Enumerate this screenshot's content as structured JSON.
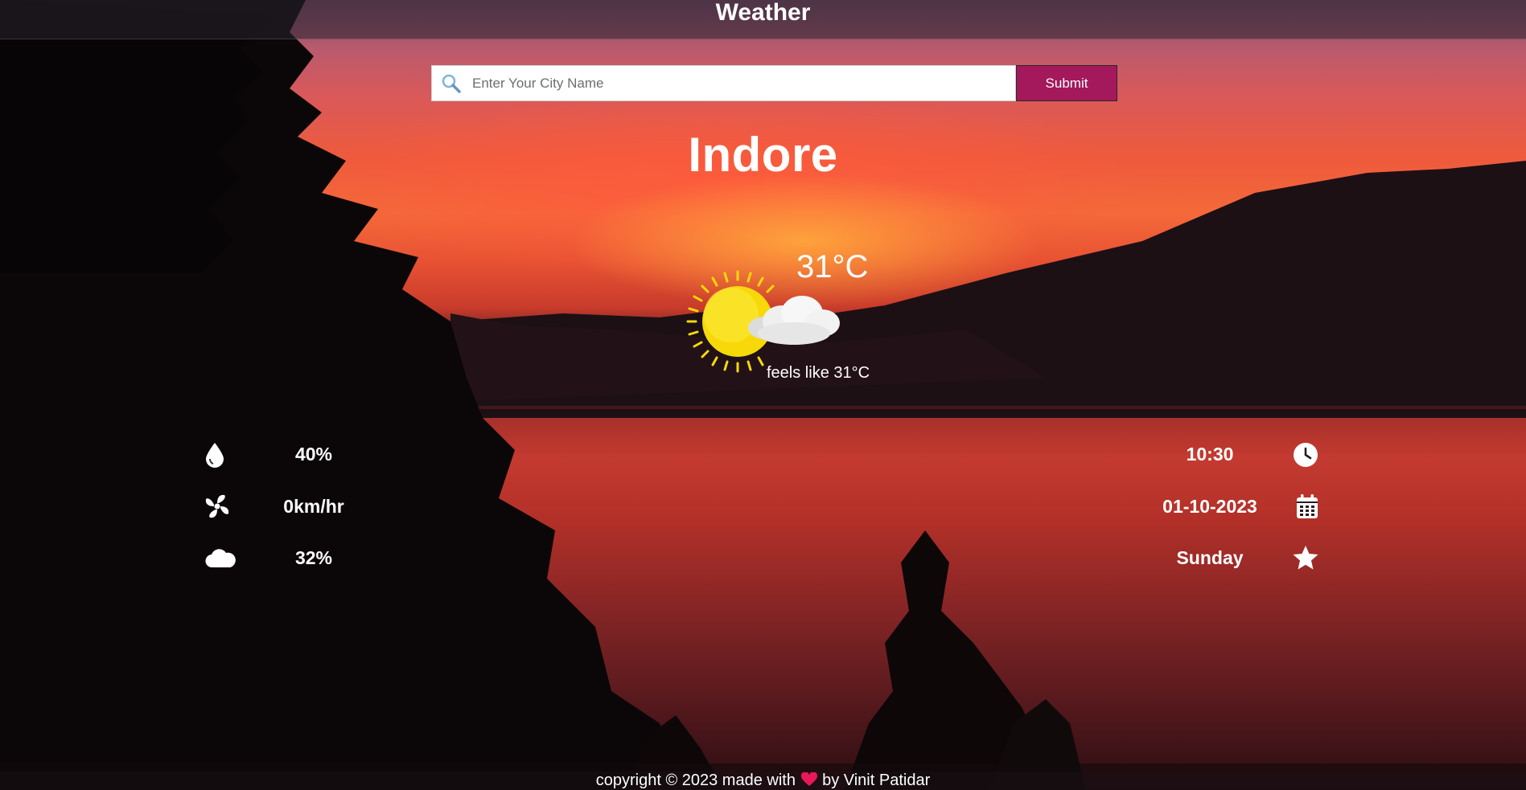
{
  "header": {
    "title": "Weather"
  },
  "search": {
    "placeholder": "Enter Your City Name",
    "value": "",
    "submit_label": "Submit"
  },
  "weather": {
    "city": "Indore",
    "temperature": "31°C",
    "feels_like": "feels like 31°C",
    "icon": "partly-cloudy-icon"
  },
  "stats_left": [
    {
      "icon": "humidity-drop-icon",
      "value": "40%"
    },
    {
      "icon": "wind-fan-icon",
      "value": "0km/hr"
    },
    {
      "icon": "cloud-icon",
      "value": "32%"
    }
  ],
  "stats_right": [
    {
      "icon": "clock-icon",
      "value": "10:30"
    },
    {
      "icon": "calendar-icon",
      "value": "01-10-2023"
    },
    {
      "icon": "star-icon",
      "value": "Sunday"
    }
  ],
  "footer": {
    "prefix": "copyright © 2023 made with",
    "suffix": "by Vinit Patidar"
  },
  "colors": {
    "submit_bg": "#a3195b",
    "heart": "#e8185a",
    "sun": "#f7d90a"
  }
}
